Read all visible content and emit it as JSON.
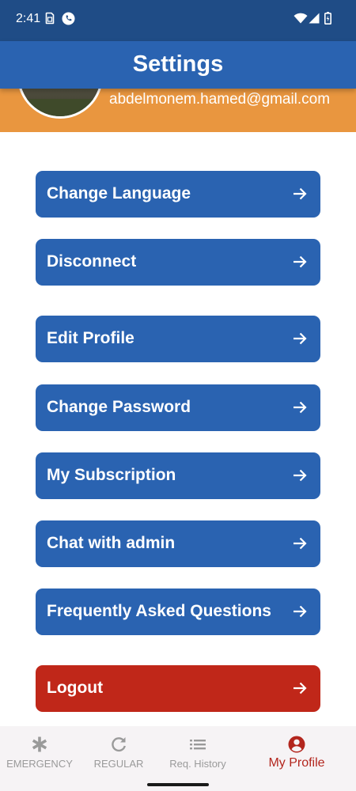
{
  "status_bar": {
    "time": "2:41"
  },
  "header": {
    "title": "Settings"
  },
  "profile": {
    "email": "abdelmonem.hamed@gmail.com"
  },
  "menu": {
    "change_language": "Change Language",
    "disconnect": "Disconnect",
    "edit_profile": "Edit Profile",
    "change_password": "Change Password",
    "my_subscription": "My Subscription",
    "chat_with_admin": "Chat with admin",
    "faq": "Frequently Asked Questions",
    "logout": "Logout"
  },
  "bottom_nav": {
    "emergency": "EMERGENCY",
    "regular": "REGULAR",
    "req_history": "Req. History",
    "my_profile": "My Profile"
  },
  "colors": {
    "status_bar": "#1f4c86",
    "app_bar": "#2a63b1",
    "profile_band": "#e9963f",
    "button": "#2a63b1",
    "logout_button": "#c02719",
    "active_nav": "#b3261e",
    "inactive_nav": "#9a9a9a"
  },
  "icons": {
    "status": [
      "sim-icon",
      "phone-call-icon",
      "wifi-icon",
      "signal-icon",
      "battery-icon"
    ],
    "menu_arrow": "arrow-right-icon",
    "nav": [
      "asterisk-icon",
      "refresh-icon",
      "list-icon",
      "account-circle-icon"
    ]
  }
}
